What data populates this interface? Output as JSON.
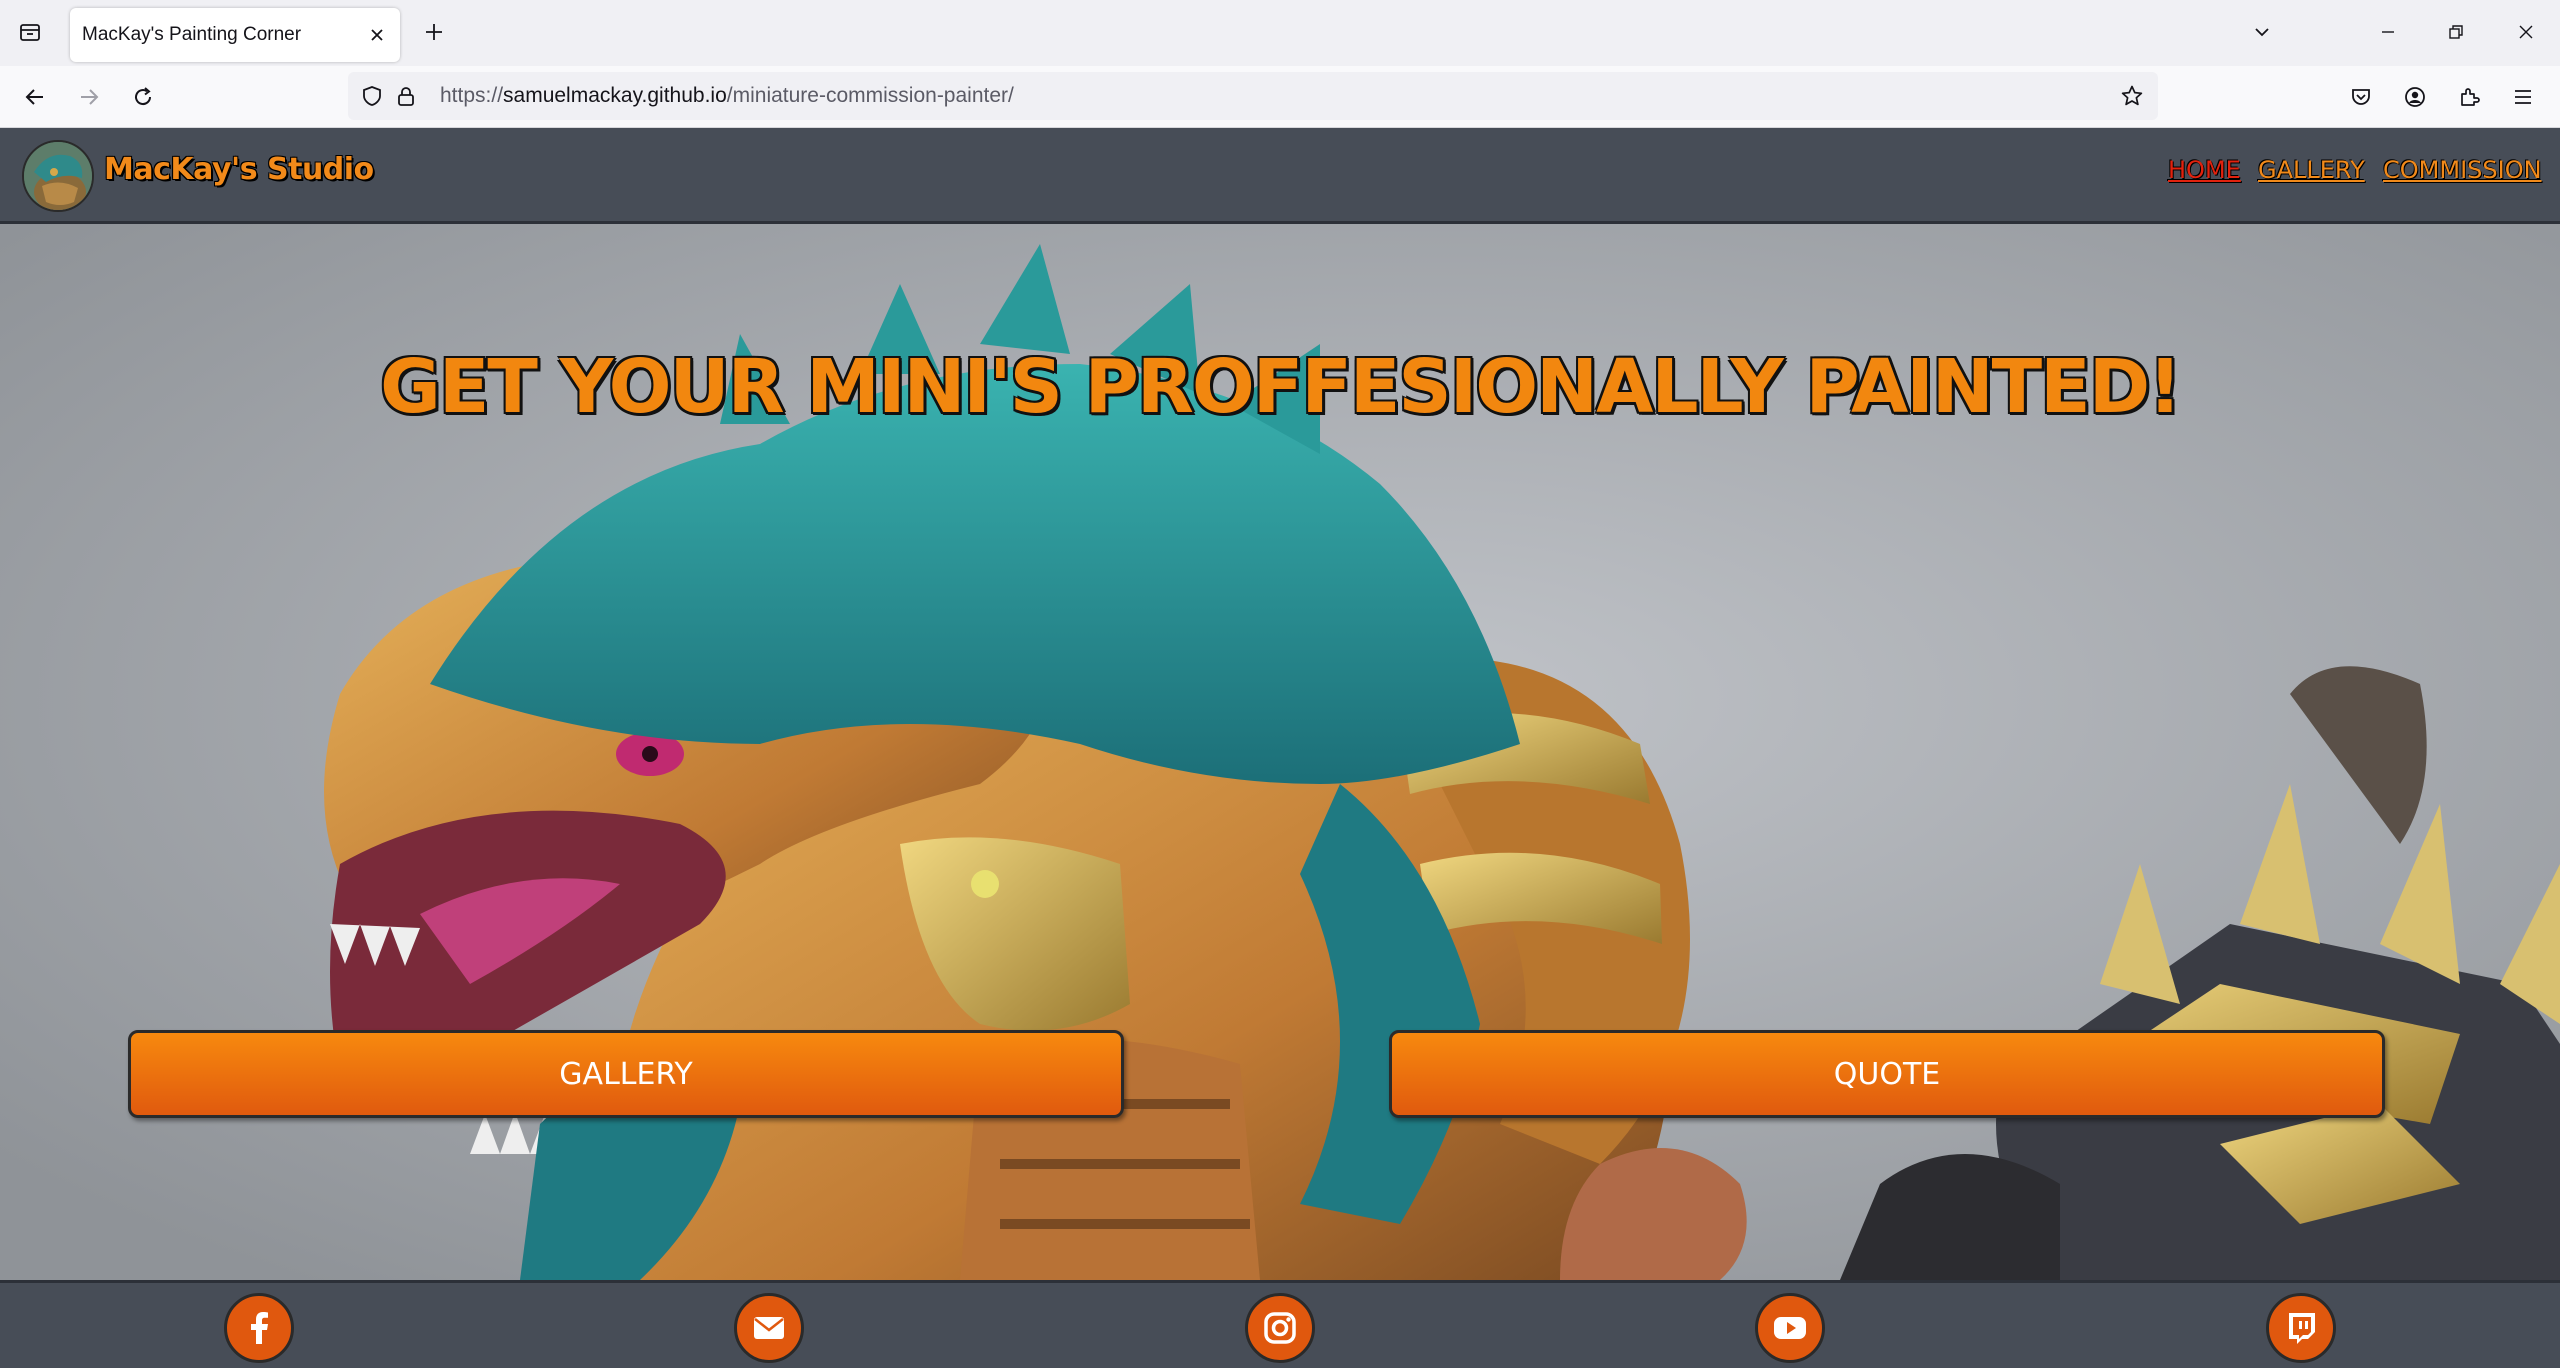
{
  "browser": {
    "tab_title": "MacKay's Painting Corner",
    "url_scheme": "https://",
    "url_host": "samuelmackay.github.io",
    "url_path": "/miniature-commission-painter/"
  },
  "site": {
    "brand": "MacKay's Studio",
    "nav": [
      {
        "label": "HOME",
        "active": true
      },
      {
        "label": "GALLERY",
        "active": false
      },
      {
        "label": "COMMISSION",
        "active": false
      }
    ],
    "hero_title": "GET YOUR MINI'S PROFFESIONALLY PAINTED!",
    "buttons": {
      "gallery": "GALLERY",
      "quote": "QUOTE"
    },
    "social": [
      "facebook-icon",
      "envelope-icon",
      "instagram-icon",
      "youtube-icon",
      "twitch-icon"
    ]
  },
  "colors": {
    "brand_orange": "#f28a1a",
    "active_nav": "#e2220e",
    "header_bg": "#474d57",
    "button_orange": "#e8650e"
  }
}
